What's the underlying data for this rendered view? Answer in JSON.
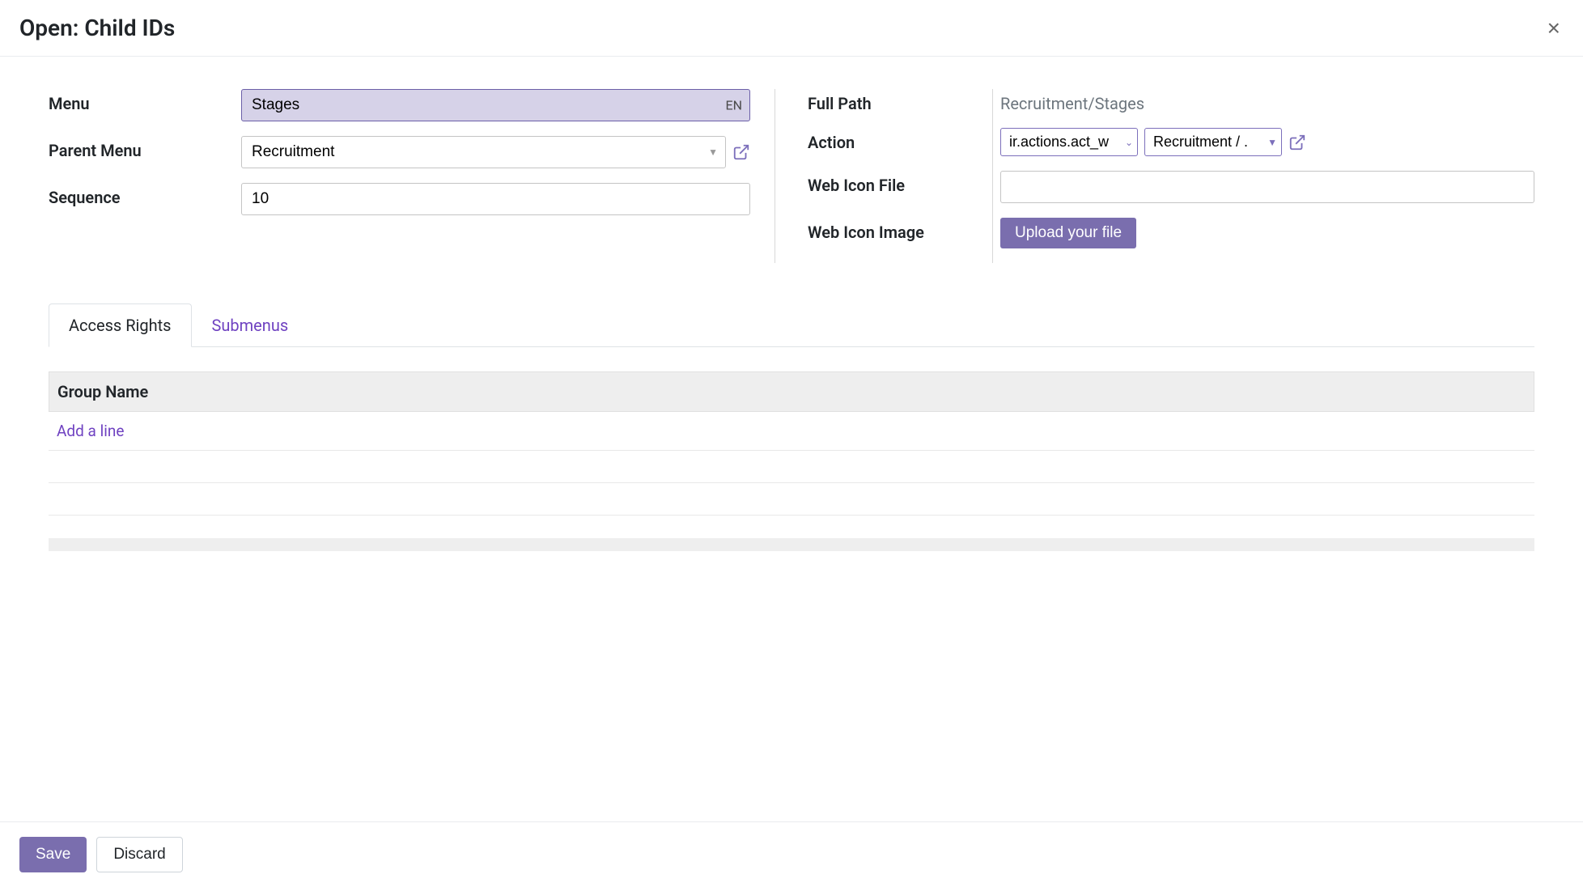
{
  "modal": {
    "title": "Open: Child IDs"
  },
  "form": {
    "left": {
      "menu_label": "Menu",
      "menu_value": "Stages",
      "menu_lang": "EN",
      "parent_menu_label": "Parent Menu",
      "parent_menu_value": "Recruitment",
      "sequence_label": "Sequence",
      "sequence_value": "10"
    },
    "right": {
      "full_path_label": "Full Path",
      "full_path_value": "Recruitment/Stages",
      "action_label": "Action",
      "action_type": "ir.actions.act_w",
      "action_value": "Recruitment / .",
      "web_icon_file_label": "Web Icon File",
      "web_icon_file_value": "",
      "web_icon_image_label": "Web Icon Image",
      "upload_label": "Upload your file"
    }
  },
  "tabs": {
    "access_rights": "Access Rights",
    "submenus": "Submenus"
  },
  "table": {
    "column_header": "Group Name",
    "add_line": "Add a line"
  },
  "footer": {
    "save": "Save",
    "discard": "Discard"
  }
}
